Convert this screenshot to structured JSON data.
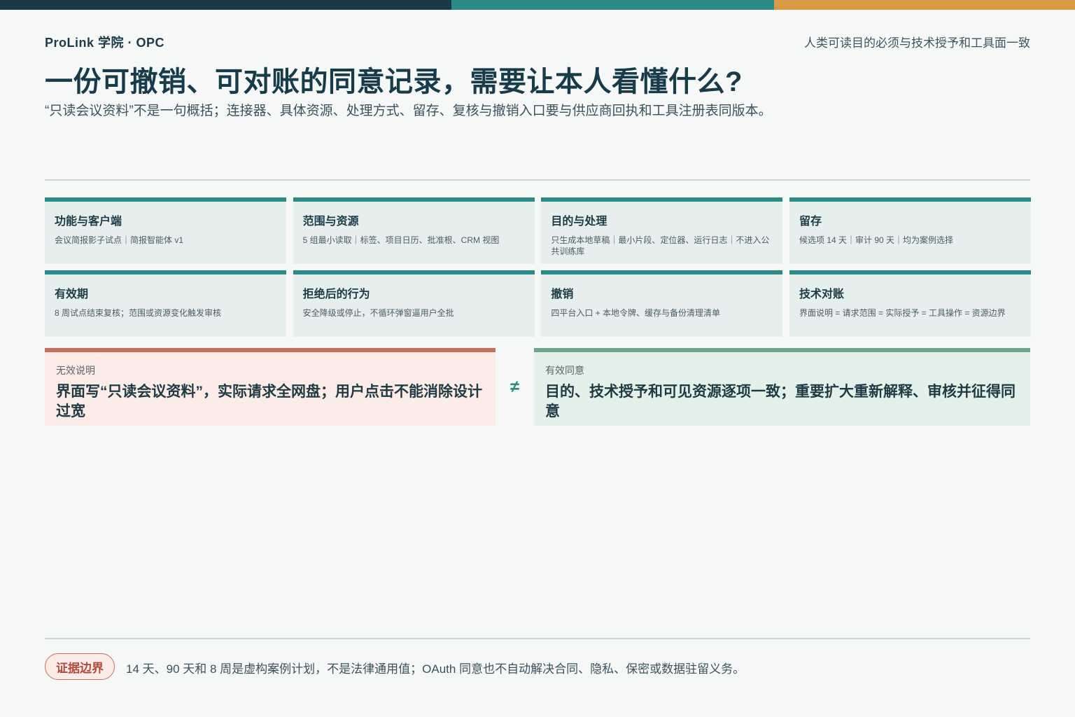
{
  "colors": {
    "background": "#f6f8f8",
    "bar_navy": "#183a48",
    "bar_teal": "#2b8a85",
    "bar_amber": "#d89a45",
    "card_accent": "#2b8a85",
    "bad_accent": "#c96c5c",
    "good_accent": "#6ea68c"
  },
  "header": {
    "brand": "ProLink 学院 · OPC",
    "tagline": "人类可读目的必须与技术授予和工具面一致",
    "title": "一份可撤销、可对账的同意记录，需要让本人看懂什么?",
    "subtitle": "“只读会议资料”不是一句概括；连接器、具体资源、处理方式、留存、复核与撤销入口要与供应商回执和工具注册表同版本。"
  },
  "cards": [
    {
      "title": "功能与客户端",
      "desc": "会议简报影子试点｜简报智能体 v1"
    },
    {
      "title": "范围与资源",
      "desc": "5 组最小读取｜标签、项目日历、批准根、CRM 视图"
    },
    {
      "title": "目的与处理",
      "desc": "只生成本地草稿｜最小片段、定位器、运行日志｜不进入公共训练库"
    },
    {
      "title": "留存",
      "desc": "候选项 14 天｜审计 90 天｜均为案例选择"
    },
    {
      "title": "有效期",
      "desc": "8 周试点结束复核；范围或资源变化触发审核"
    },
    {
      "title": "拒绝后的行为",
      "desc": "安全降级或停止，不循环弹窗逼用户全批"
    },
    {
      "title": "撤销",
      "desc": "四平台入口 + 本地令牌、缓存与备份清理清单"
    },
    {
      "title": "技术对账",
      "desc": "界面说明 = 请求范围 = 实际授予 = 工具操作 = 资源边界"
    }
  ],
  "comparison": {
    "invalid_label": "无效说明",
    "invalid_text": "界面写“只读会议资料”，实际请求全网盘；用户点击不能消除设计过宽",
    "symbol": "≠",
    "valid_label": "有效同意",
    "valid_text": "目的、技术授予和可见资源逐项一致；重要扩大重新解释、审核并征得同意"
  },
  "footer": {
    "badge": "证据边界",
    "note": "14 天、90 天和 8 周是虚构案例计划，不是法律通用值；OAuth 同意也不自动解决合同、隐私、保密或数据驻留义务。"
  }
}
